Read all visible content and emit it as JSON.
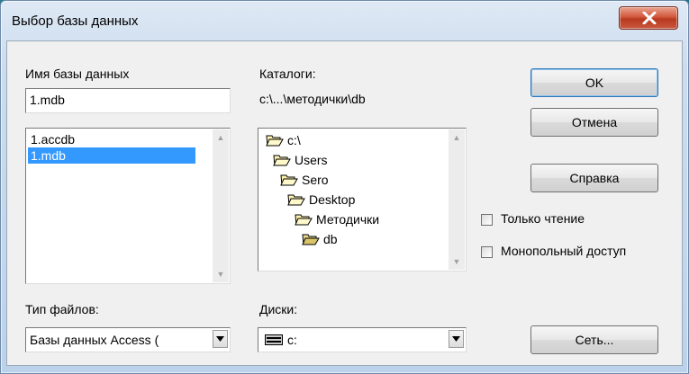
{
  "window": {
    "title": "Выбор базы данных"
  },
  "db_name": {
    "label": "Имя базы данных",
    "value": "1.mdb",
    "files": [
      {
        "name": "1.accdb",
        "selected": false
      },
      {
        "name": "1.mdb",
        "selected": true
      }
    ]
  },
  "catalogs": {
    "label": "Каталоги:",
    "current_path": "c:\\...\\методички\\db",
    "folders": [
      "c:\\",
      "Users",
      "Sero",
      "Desktop",
      "Методички",
      "db"
    ]
  },
  "file_type": {
    "label": "Тип файлов:",
    "value": "Базы данных Access ("
  },
  "drives": {
    "label": "Диски:",
    "value": "c:"
  },
  "buttons": {
    "ok": "OK",
    "cancel": "Отмена",
    "help": "Справка",
    "network": "Сеть..."
  },
  "options": {
    "read_only": {
      "label": "Только чтение",
      "checked": false
    },
    "exclusive": {
      "label": "Монопольный доступ",
      "checked": false
    }
  }
}
